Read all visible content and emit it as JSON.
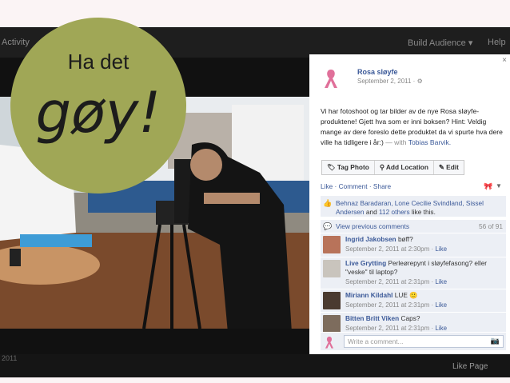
{
  "overlay": {
    "line1": "Ha det",
    "line2": "gøy!"
  },
  "topbar": {
    "left_text": "Activity",
    "build_audience": "Build Audience ▾",
    "help": "Help"
  },
  "bottombar": {
    "like_page": "Like Page",
    "left_tag": "2011"
  },
  "post": {
    "author": "Rosa sløyfe",
    "date": "September 2, 2011 · ⚙",
    "text": "Vi har fotoshoot og tar bilder av de nye Rosa sløyfe-produktene! Gjett hva som er inni boksen? Hint: Veldig mange av dere foreslo dette produktet da vi spurte hva dere ville ha tidligere i år:)",
    "with_prefix": "— with",
    "with_name": "Tobias Barvik.",
    "actions": [
      "Tag Photo",
      "Add Location",
      "Edit"
    ],
    "action_icons": [
      "tag-icon",
      "location-pin-icon",
      "pencil-icon"
    ],
    "lcs": "Like · Comment · Share",
    "likes_names": "Behnaz Baradaran, Lone Cecilie Svindland, Sissel Andersen",
    "likes_and": "and",
    "likes_others": "112 others",
    "likes_suffix": "like this.",
    "view_previous": "View previous comments",
    "count": "56 of 91",
    "close": "×"
  },
  "comments": [
    {
      "name": "Ingrid Jakobsen",
      "text": "bøff?",
      "time": "September 2, 2011 at 2:30pm · ",
      "like": "Like"
    },
    {
      "name": "Live Grytting",
      "text": "Perleørepynt i sløyfefasong? eller \"veske\" til laptop?",
      "time": "September 2, 2011 at 2:31pm · ",
      "like": "Like"
    },
    {
      "name": "Miriann Kildahl",
      "text": "LUE 🙂",
      "time": "September 2, 2011 at 2:31pm · ",
      "like": "Like"
    },
    {
      "name": "Bitten Britt Viken",
      "text": "Caps?",
      "time": "September 2, 2011 at 2:31pm · ",
      "like": "Like"
    }
  ],
  "write_comment": {
    "placeholder": "Write a comment..."
  },
  "colors": {
    "fb_blue": "#3b5998",
    "badge_green": "#a0a756",
    "ribbon_pink": "#e0709a"
  }
}
